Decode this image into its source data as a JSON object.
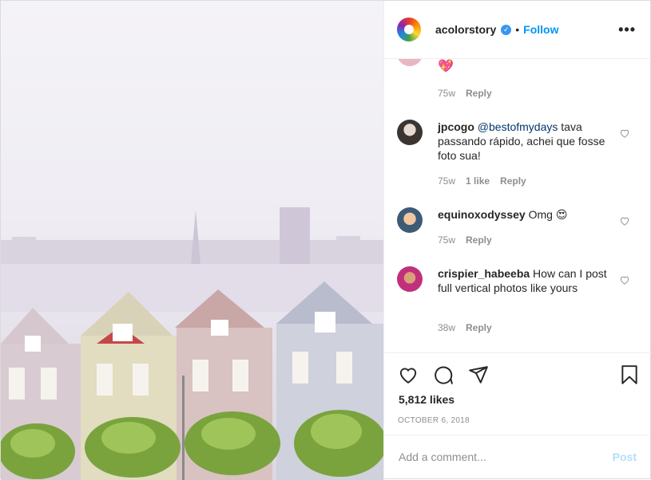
{
  "header": {
    "username": "acolorstory",
    "separator": "•",
    "follow_label": "Follow",
    "more_label": "•••"
  },
  "comments": [
    {
      "user": "",
      "text": "",
      "emoji": "💖",
      "time": "75w",
      "likes": "",
      "reply": "Reply"
    },
    {
      "user": "jpcogo",
      "mention": "@bestofmydays",
      "text": " tava passando rápido, achei que fosse foto sua!",
      "time": "75w",
      "likes": "1 like",
      "reply": "Reply"
    },
    {
      "user": "equinoxodyssey",
      "text": " Omg 😍",
      "time": "75w",
      "likes": "",
      "reply": "Reply"
    },
    {
      "user": "crispier_habeeba",
      "text": " How can I post full vertical photos like yours",
      "time": "38w",
      "likes": "",
      "reply": "Reply"
    }
  ],
  "post": {
    "likes": "5,812 likes",
    "date": "OCTOBER 6, 2018"
  },
  "composer": {
    "placeholder": "Add a comment...",
    "post_label": "Post"
  },
  "icons": [
    "heart-icon",
    "comment-icon",
    "share-icon",
    "bookmark-icon",
    "more-icon",
    "verified-icon"
  ],
  "colors": {
    "accent": "#0095f6",
    "verified": "#3897f0",
    "muted": "#8e8e8e",
    "post_disabled": "#b2dffc"
  }
}
